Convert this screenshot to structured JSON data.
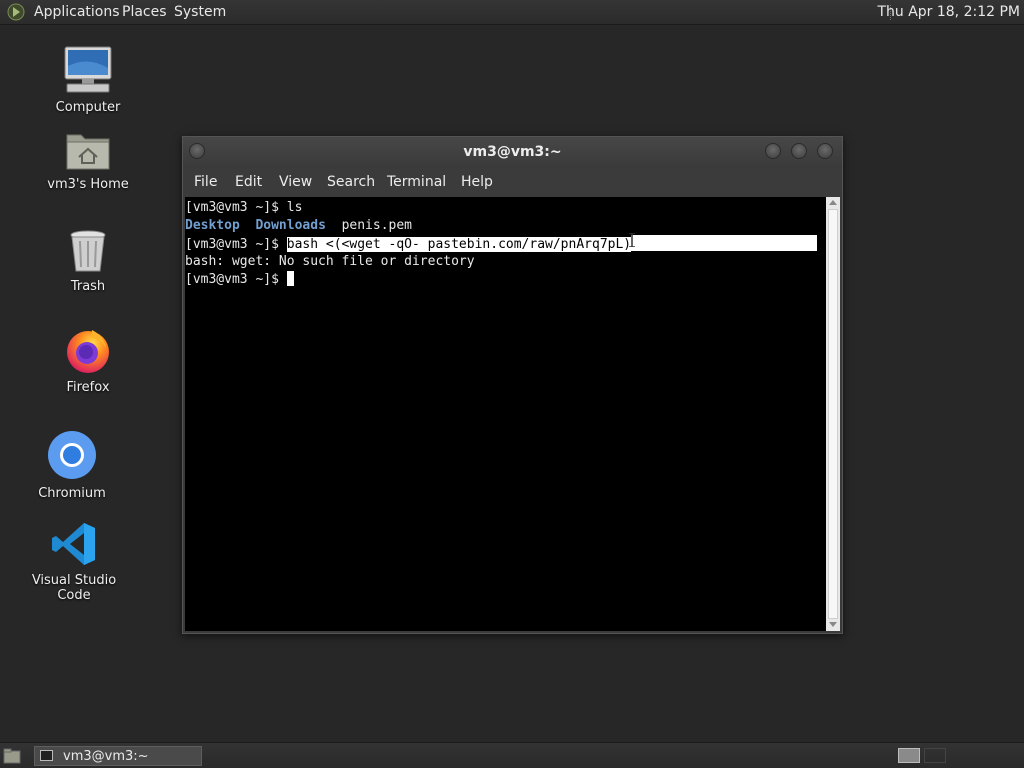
{
  "topbar": {
    "menus": [
      "Applications",
      "Places",
      "System"
    ],
    "clock": "Thu Apr 18,  2:12 PM"
  },
  "desktop": {
    "icons": [
      {
        "label": "Computer",
        "icon": "computer-icon"
      },
      {
        "label": "vm3's Home",
        "icon": "home-folder-icon"
      },
      {
        "label": "Trash",
        "icon": "trash-icon"
      },
      {
        "label": "Firefox",
        "icon": "firefox-icon"
      },
      {
        "label": "Chromium",
        "icon": "chromium-icon"
      },
      {
        "label": "Visual Studio Code",
        "icon": "vscode-icon"
      }
    ]
  },
  "window": {
    "title": "vm3@vm3:~",
    "menu": [
      "File",
      "Edit",
      "View",
      "Search",
      "Terminal",
      "Help"
    ]
  },
  "terminal": {
    "prompt": "[vm3@vm3 ~]$ ",
    "cmd1": "ls",
    "ls_dirs": [
      "Desktop",
      "Downloads"
    ],
    "ls_file": "penis.pem",
    "cmd2": "bash <(<wget -qO- pastebin.com/raw/pnArq7pL)",
    "error": "bash: wget: No such file or directory"
  },
  "taskbar": {
    "task_label": "vm3@vm3:~"
  },
  "colors": {
    "dir_blue": "#729fcf",
    "terminal_bg": "#000000",
    "desktop_bg": "#272727"
  }
}
